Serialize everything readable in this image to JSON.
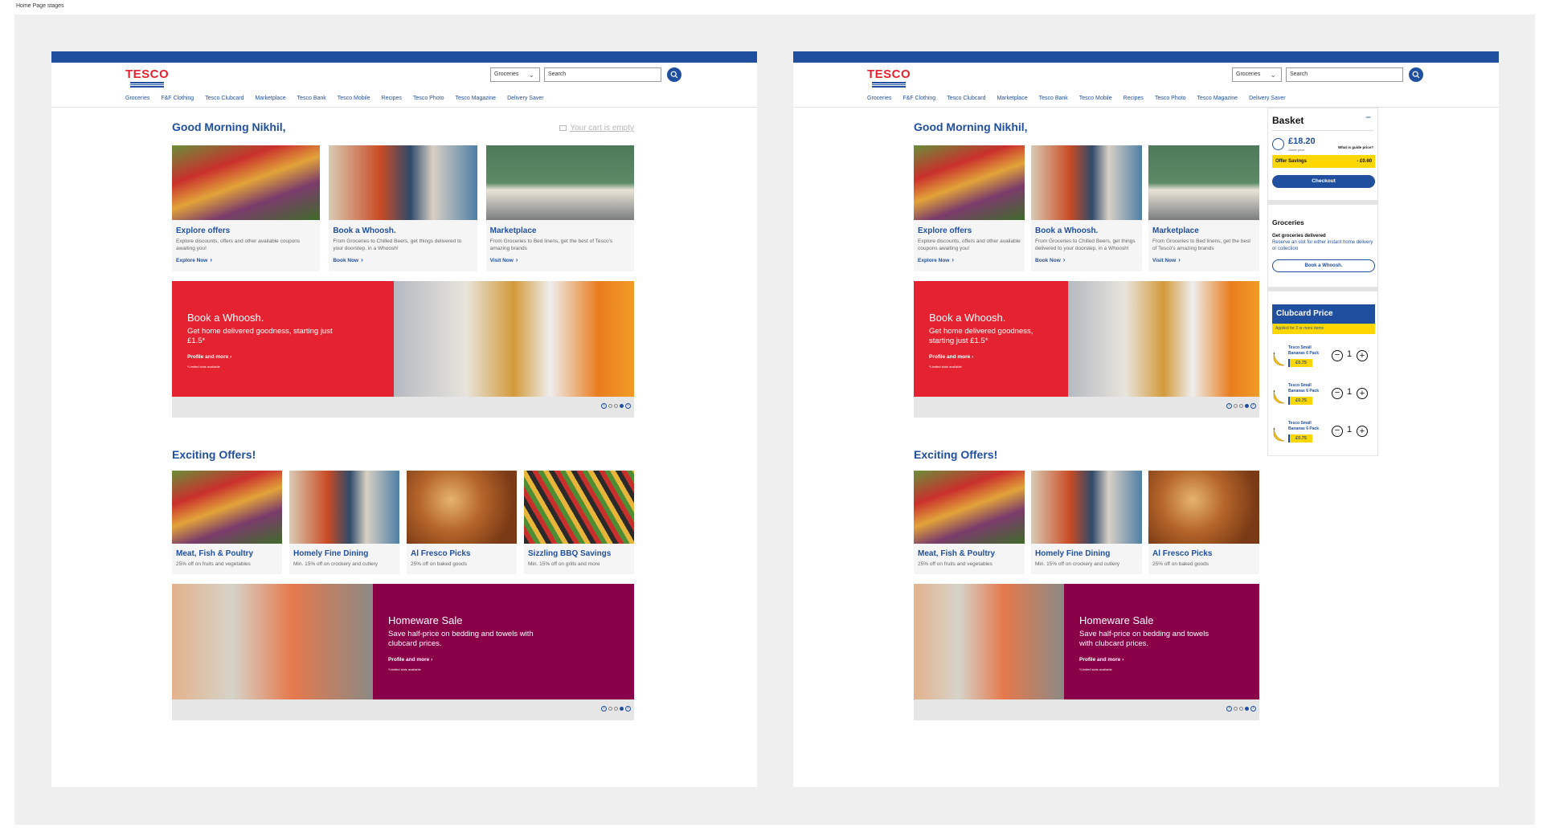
{
  "frame_label": "Home Page stages",
  "header": {
    "logo": "TESCO",
    "category_select": "Groceries",
    "search_placeholder": "Search",
    "nav": [
      "Groceries",
      "F&F Clothing",
      "Tesco Clubcard",
      "Marketplace",
      "Tesco Bank",
      "Tesco Mobile",
      "Recipes",
      "Tesco Photo",
      "Tesco Magazine",
      "Delivery Saver"
    ]
  },
  "main": {
    "greeting": "Good Morning Nikhil,",
    "cart_empty": "Your cart is empty",
    "cards": [
      {
        "title": "Explore offers",
        "desc": "Explore discounts, offers and other available coupons awaiting you!",
        "link": "Explore Now"
      },
      {
        "title": "Book a Whoosh.",
        "desc": "From Groceries to Chilled Beers, get things delivered to your doorstep, in a Whoosh!",
        "link": "Book Now"
      },
      {
        "title": "Marketplace",
        "desc": "From Groceries to Bed linens, get the best of Tesco's amazing brands",
        "link": "Visit Now"
      }
    ],
    "banner1": {
      "title": "Book a Whoosh.",
      "text": "Get home delivered goodness, starting just £1.5*",
      "link": "Profile and more",
      "fine": "*Limited slots available",
      "color": "#e52330"
    },
    "offers_title": "Exciting Offers!",
    "offers": [
      {
        "title": "Meat, Fish & Poultry",
        "desc": "25% off on fruits and vegetables"
      },
      {
        "title": "Homely Fine Dining",
        "desc": "Min. 15% off on crockery and cutlery"
      },
      {
        "title": "Al Fresco Picks",
        "desc": "25% off on baked goods"
      },
      {
        "title": "Sizzling BBQ Savings",
        "desc": "Min. 15% off on grills and more"
      }
    ],
    "banner2": {
      "title": "Homeware Sale",
      "text": "Save half-price on bedding and towels with clubcard prices.",
      "link": "Profile and more",
      "fine": "*Limited slots available",
      "color": "#8a0048"
    }
  },
  "basket": {
    "title": "Basket",
    "collapse": "−",
    "total": "£18.20",
    "guide_price": "Guide price",
    "what_is_guide": "What is guide price?",
    "offer_label": "Offer Savings",
    "offer_value": "- £0.60",
    "checkout": "Checkout",
    "groceries_title": "Groceries",
    "groceries_heading": "Get groceries delivered",
    "groceries_text": "Reserve an slot for either instant home delivery or collection",
    "book_button": "Book a Whoosh.",
    "clubcard_title": "Clubcard Price",
    "clubcard_sub": "Applied for 2 or more items",
    "items": [
      {
        "name": "Tesco Small Bananas 6 Pack",
        "price": "£0.75",
        "qty": "1"
      },
      {
        "name": "Tesco Small Bananas 6 Pack",
        "price": "£0.75",
        "qty": "1"
      },
      {
        "name": "Tesco Small Bananas 6 Pack",
        "price": "£0.75",
        "qty": "1"
      }
    ]
  },
  "colors": {
    "brand_blue": "#1f4f9e",
    "tesco_red": "#e52330",
    "highlight_yellow": "#ffd700"
  }
}
